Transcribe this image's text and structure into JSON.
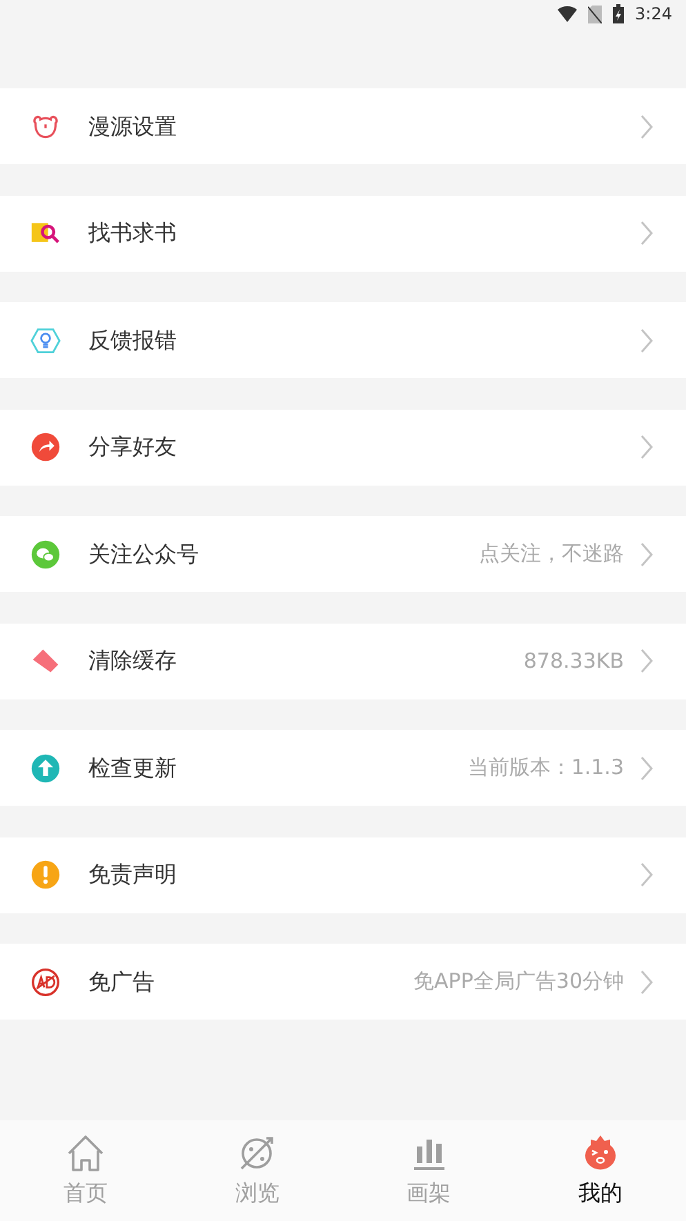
{
  "status_bar": {
    "time": "3:24"
  },
  "menu": [
    {
      "kind": "bear",
      "label": "漫源设置"
    },
    {
      "kind": "search-book",
      "label": "找书求书"
    },
    {
      "kind": "bulb",
      "label": "反馈报错"
    },
    {
      "kind": "share",
      "label": "分享好友"
    },
    {
      "kind": "chat",
      "label": "关注公众号",
      "value": "点关注，不迷路"
    },
    {
      "kind": "eraser",
      "label": "清除缓存",
      "value": "878.33KB"
    },
    {
      "kind": "upload",
      "label": "检查更新",
      "value": "当前版本：1.1.3"
    },
    {
      "kind": "alert",
      "label": "免责声明"
    },
    {
      "kind": "ad",
      "label": "免广告",
      "value": "免APP全局广告30分钟"
    }
  ],
  "tabs": [
    {
      "kind": "home",
      "label": "首页",
      "selected": false
    },
    {
      "kind": "planet",
      "label": "浏览",
      "selected": false
    },
    {
      "kind": "shelf",
      "label": "画架",
      "selected": false
    },
    {
      "kind": "mascot",
      "label": "我的",
      "selected": true
    }
  ]
}
